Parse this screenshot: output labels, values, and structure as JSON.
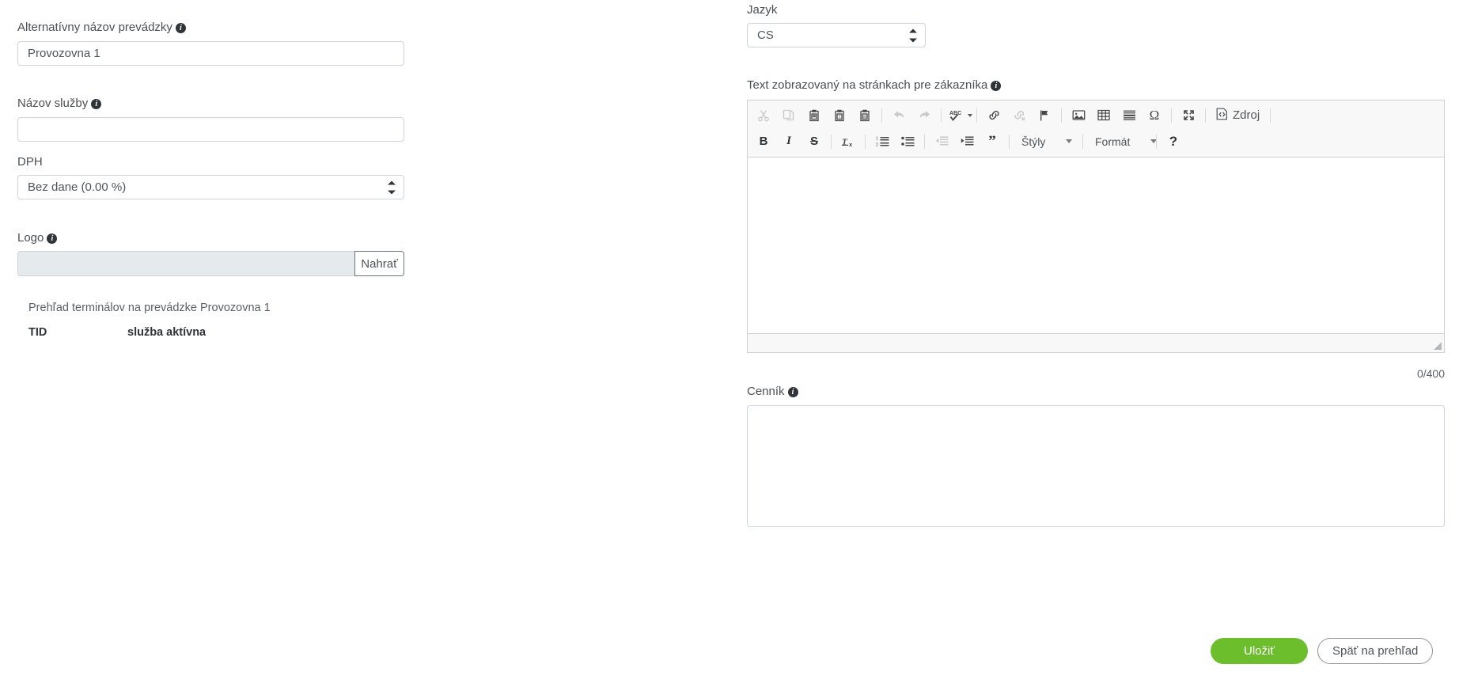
{
  "colors": {
    "accent_green": "#6cbe2c",
    "field_border": "#ced4da",
    "toolbar_bg": "#f8f8f8",
    "disabled_field": "#e5eaed",
    "label_text": "#4a4f54"
  },
  "left_column": {
    "alt_name": {
      "label": "Alternatívny názov prevádzky",
      "info_icon": "info-icon",
      "value": "Provozovna 1",
      "placeholder": ""
    },
    "service_name": {
      "label": "Názov služby",
      "info_icon": "info-icon",
      "value": "",
      "placeholder": ""
    },
    "vat": {
      "label": "DPH",
      "selected": "Bez dane (0.00 %)",
      "options": [
        "Bez dane (0.00 %)"
      ]
    },
    "logo": {
      "label": "Logo",
      "info_icon": "info-icon",
      "value": "",
      "upload_label": "Nahrať"
    },
    "terminals": {
      "title": "Prehľad terminálov na prevádzke Provozovna 1",
      "columns": [
        "TID",
        "služba aktívna"
      ],
      "rows": []
    }
  },
  "right_column": {
    "language": {
      "label": "Jazyk",
      "selected": "CS",
      "options": [
        "CS"
      ]
    },
    "customer_text": {
      "label": "Text zobrazovaný na stránkach pre zákazníka",
      "info_icon": "info-icon",
      "content": "",
      "counter": "0/400"
    },
    "editor_toolbar": {
      "row1": [
        {
          "name": "cut-icon",
          "title": "Vystrihnúť",
          "disabled": true
        },
        {
          "name": "copy-icon",
          "title": "Kopírovať",
          "disabled": true
        },
        {
          "name": "paste-icon",
          "title": "Prilepiť",
          "disabled": false
        },
        {
          "name": "paste-text-icon",
          "title": "Prilepiť ako čistý text",
          "disabled": false
        },
        {
          "name": "paste-word-icon",
          "title": "Prilepiť z Wordu",
          "disabled": false
        },
        {
          "name": "separator",
          "title": "",
          "disabled": false
        },
        {
          "name": "undo-icon",
          "title": "Späť",
          "disabled": true
        },
        {
          "name": "redo-icon",
          "title": "Znovu",
          "disabled": true
        },
        {
          "name": "separator",
          "title": "",
          "disabled": false
        },
        {
          "name": "spellcheck-icon",
          "title": "Kontrola pravopisu",
          "disabled": false
        },
        {
          "name": "separator",
          "title": "",
          "disabled": false
        },
        {
          "name": "link-icon",
          "title": "Vložiť odkaz",
          "disabled": false
        },
        {
          "name": "unlink-icon",
          "title": "Odstrániť odkaz",
          "disabled": true
        },
        {
          "name": "anchor-flag-icon",
          "title": "Kotva",
          "disabled": false
        },
        {
          "name": "separator",
          "title": "",
          "disabled": false
        },
        {
          "name": "image-icon",
          "title": "Obrázok",
          "disabled": false
        },
        {
          "name": "table-icon",
          "title": "Tabuľka",
          "disabled": false
        },
        {
          "name": "horizontal-rule-icon",
          "title": "Vodorovná čiara",
          "disabled": false
        },
        {
          "name": "special-char-icon",
          "title": "Špeciálny znak",
          "disabled": false
        },
        {
          "name": "separator",
          "title": "",
          "disabled": false
        },
        {
          "name": "maximize-icon",
          "title": "Maximalizovať",
          "disabled": false
        },
        {
          "name": "separator",
          "title": "",
          "disabled": false
        },
        {
          "name": "source-icon",
          "title": "Zdroj",
          "disabled": false
        }
      ],
      "source_label": "Zdroj",
      "row2": [
        {
          "name": "bold-icon",
          "title": "Tučné",
          "disabled": false
        },
        {
          "name": "italic-icon",
          "title": "Kurzíva",
          "disabled": false
        },
        {
          "name": "strikethrough-icon",
          "title": "Prečiarknuté",
          "disabled": false
        },
        {
          "name": "separator",
          "title": "",
          "disabled": false
        },
        {
          "name": "remove-format-icon",
          "title": "Odstrániť formátovanie",
          "disabled": false
        },
        {
          "name": "separator",
          "title": "",
          "disabled": false
        },
        {
          "name": "numbered-list-icon",
          "title": "Číslovaný zoznam",
          "disabled": false
        },
        {
          "name": "bulleted-list-icon",
          "title": "Odrážkový zoznam",
          "disabled": false
        },
        {
          "name": "separator",
          "title": "",
          "disabled": false
        },
        {
          "name": "outdent-icon",
          "title": "Zmenšiť odsadenie",
          "disabled": true
        },
        {
          "name": "indent-icon",
          "title": "Zväčšiť odsadenie",
          "disabled": false
        },
        {
          "name": "blockquote-icon",
          "title": "Citácia",
          "disabled": false
        },
        {
          "name": "separator",
          "title": "",
          "disabled": false
        }
      ],
      "styles_combo": "Štýly",
      "format_combo": "Formát",
      "help_label": "?"
    },
    "price_list": {
      "label": "Cenník",
      "info_icon": "info-icon",
      "value": "",
      "placeholder": ""
    },
    "actions": {
      "save_label": "Uložiť",
      "back_label": "Späť na prehľad"
    }
  }
}
